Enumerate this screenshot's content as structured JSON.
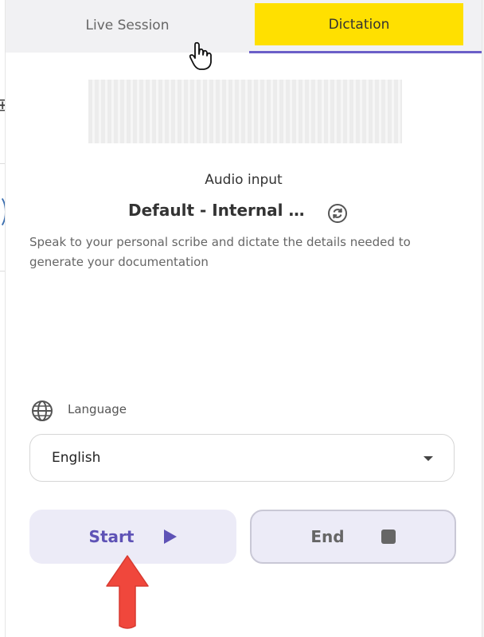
{
  "tabs": [
    {
      "label": "Live Session",
      "active": false
    },
    {
      "label": "Dictation",
      "active": true
    }
  ],
  "audio": {
    "label": "Audio input",
    "device": "Default - Internal Microphone",
    "refresh_icon": "refresh-icon"
  },
  "description": "Speak to your personal scribe and dictate the details needed to generate your documentation",
  "language": {
    "label": "Language",
    "icon": "globe-icon",
    "selected": "English"
  },
  "actions": {
    "start_label": "Start",
    "end_label": "End"
  },
  "colors": {
    "active_tab_bg": "#ffe000",
    "accent": "#6b5fc8",
    "button_bg": "#ecebf7",
    "annotation_arrow": "#f0473c"
  }
}
